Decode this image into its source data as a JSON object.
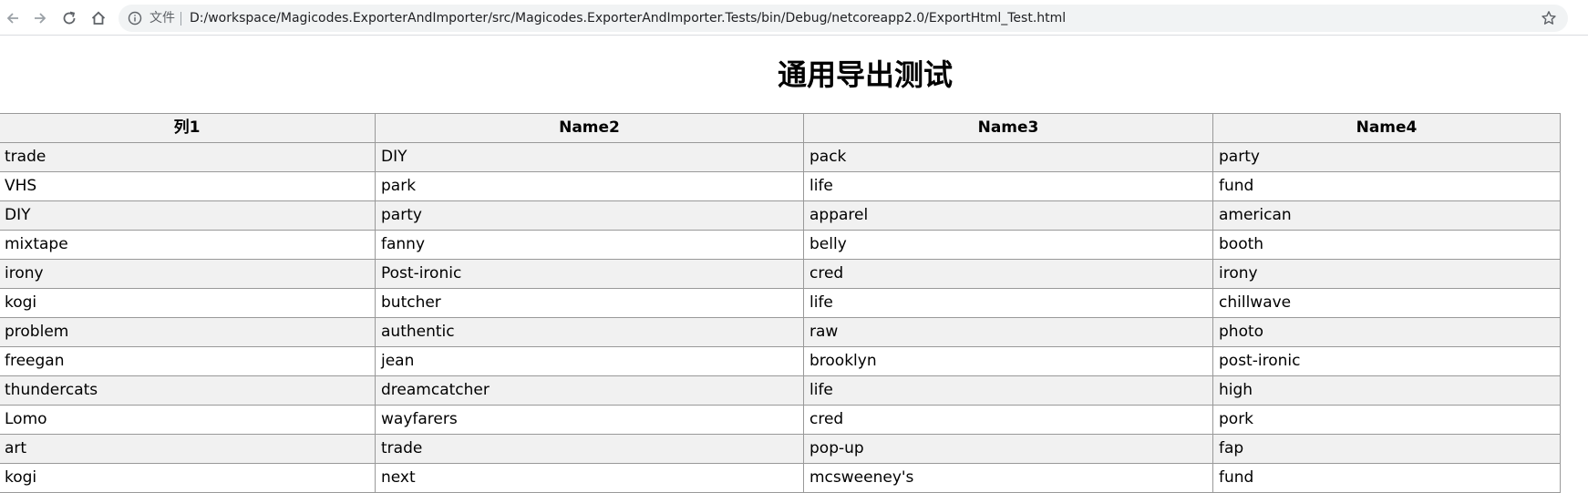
{
  "browser": {
    "file_label": "文件",
    "url": "D:/workspace/Magicodes.ExporterAndImporter/src/Magicodes.ExporterAndImporter.Tests/bin/Debug/netcoreapp2.0/ExportHtml_Test.html"
  },
  "page": {
    "title": "通用导出测试"
  },
  "table": {
    "headers": [
      "列1",
      "Name2",
      "Name3",
      "Name4"
    ],
    "rows": [
      [
        "trade",
        "DIY",
        "pack",
        "party"
      ],
      [
        "VHS",
        "park",
        "life",
        "fund"
      ],
      [
        "DIY",
        "party",
        "apparel",
        "american"
      ],
      [
        "mixtape",
        "fanny",
        "belly",
        "booth"
      ],
      [
        "irony",
        "Post-ironic",
        "cred",
        "irony"
      ],
      [
        "kogi",
        "butcher",
        "life",
        "chillwave"
      ],
      [
        "problem",
        "authentic",
        "raw",
        "photo"
      ],
      [
        "freegan",
        "jean",
        "brooklyn",
        "post-ironic"
      ],
      [
        "thundercats",
        "dreamcatcher",
        "life",
        "high"
      ],
      [
        "Lomo",
        "wayfarers",
        "cred",
        "pork"
      ],
      [
        "art",
        "trade",
        "pop-up",
        "fap"
      ],
      [
        "kogi",
        "next",
        "mcsweeney's",
        "fund"
      ]
    ]
  }
}
